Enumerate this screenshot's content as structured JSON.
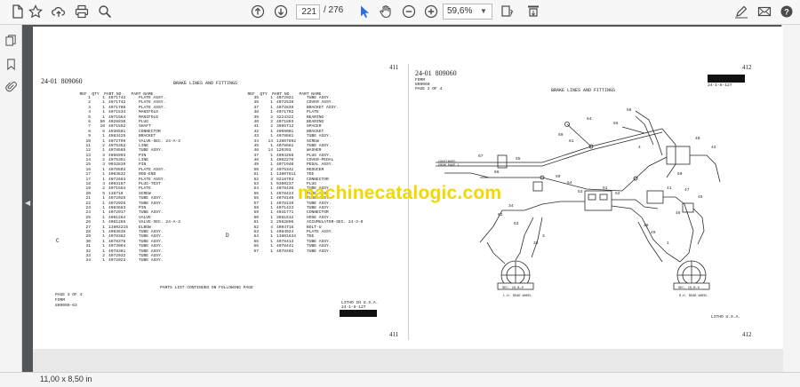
{
  "toolbar": {
    "current_page": "221",
    "total_pages": "/ 276",
    "zoom": "59,6%"
  },
  "status": {
    "page_size": "11,00 x 8,50 in"
  },
  "watermark": "machinecatalogic.com",
  "left_page": {
    "header_code": "24-01",
    "header_serial": "809060",
    "page_number": "411",
    "title": "BRAKE LINES AND FITTINGS",
    "col_headers": [
      "REF",
      "QTY",
      "PART NO",
      "PART NAME"
    ],
    "left_rows": [
      [
        "1",
        "1",
        "4071742",
        "PLATE ASSY."
      ],
      [
        "2",
        "1",
        "4071742",
        "PLATE ASSY."
      ],
      [
        "3",
        "1",
        "4071706",
        "PLATE ASSY."
      ],
      [
        "4",
        "1",
        "4071534",
        "MANIFOLD"
      ],
      [
        "5",
        "1",
        "4071564",
        "MANIFOLD"
      ],
      [
        "6",
        "50",
        "4026830",
        "PLUG"
      ],
      [
        "7",
        "10",
        "4071552",
        "SHAFT"
      ],
      [
        "8",
        "6",
        "4036581",
        "CONNECTOR"
      ],
      [
        "9",
        "1",
        "4083425",
        "BRACKET"
      ],
      [
        "10",
        "1",
        "4072799",
        "VALVE-SEC. 24-A-3"
      ],
      [
        "11",
        "2",
        "4075352",
        "LINE"
      ],
      [
        "12",
        "1",
        "4078585",
        "TUBE ASSY."
      ],
      [
        "13",
        "3",
        "4066993",
        "PIN"
      ],
      [
        "14",
        "2",
        "4075351",
        "LINE"
      ],
      [
        "15",
        "3",
        "9032839",
        "PIN"
      ],
      [
        "16",
        "1",
        "4078503",
        "PLATE ASSY."
      ],
      [
        "17",
        "1",
        "4083632",
        "ROD-END"
      ],
      [
        "17",
        "1",
        "4072663",
        "PLATE ASSY."
      ],
      [
        "18",
        "4",
        "4093187",
        "PLUG-TEST"
      ],
      [
        "19",
        "2",
        "4071554",
        "PLATE"
      ],
      [
        "20",
        "5",
        "138719",
        "SCREW"
      ],
      [
        "21",
        "1",
        "4072025",
        "TUBE ASSY."
      ],
      [
        "22",
        "1",
        "4072026",
        "TUBE ASSY."
      ],
      [
        "23",
        "1",
        "4083683",
        "PIN"
      ],
      [
        "24",
        "1",
        "4072017",
        "TUBE ASSY."
      ],
      [
        "25",
        "1",
        "4061264",
        "VALVE"
      ],
      [
        "26",
        "1",
        "4061265",
        "VALVE-SEC. 24-A-3"
      ],
      [
        "27",
        "1",
        "13802215",
        "ELBOW"
      ],
      [
        "28",
        "1",
        "4083635",
        "TUBE ASSY."
      ],
      [
        "29",
        "1",
        "4078382",
        "TUBE ASSY."
      ],
      [
        "30",
        "1",
        "4078378",
        "TUBE ASSY."
      ],
      [
        "31",
        "1",
        "4073094",
        "TUBE ASSY."
      ],
      [
        "32",
        "1",
        "4078381",
        "TUBE ASSY."
      ],
      [
        "33",
        "2",
        "4072032",
        "TUBE ASSY."
      ],
      [
        "34",
        "1",
        "4072023",
        "TUBE ASSY."
      ]
    ],
    "left_markers": {
      "C": "C"
    },
    "right_rows": [
      [
        "35",
        "1",
        "4072021",
        "TUBE ASSY."
      ],
      [
        "36",
        "1",
        "4072539",
        "COVER ASSY."
      ],
      [
        "37",
        "1",
        "4072839",
        "BRACKET ASSY."
      ],
      [
        "38",
        "1",
        "4071702",
        "PLATE"
      ],
      [
        "39",
        "2",
        "3224322",
        "BEARING"
      ],
      [
        "40",
        "2",
        "4071893",
        "BEARING"
      ],
      [
        "41",
        "2",
        "3985712",
        "SPACER"
      ],
      [
        "42",
        "1",
        "4069001",
        "BRACKET"
      ],
      [
        "43",
        "1",
        "4078661",
        "TUBE ASSY."
      ],
      [
        "44",
        "14",
        "13807692",
        "SCREW"
      ],
      [
        "45",
        "1",
        "4078662",
        "TUBE ASSY."
      ],
      [
        "46",
        "14",
        "120393",
        "WASHER"
      ],
      [
        "47",
        "1",
        "4094266",
        "PLUG ASSY."
      ],
      [
        "48",
        "1",
        "4062270",
        "COVER-PEDAL"
      ],
      [
        "49",
        "1",
        "4071940",
        "PEDAL ASSY."
      ],
      [
        "50",
        "2",
        "4075342",
        "REDUCER"
      ],
      [
        "51",
        "1",
        "13807611",
        "TEE"
      ],
      [
        "52",
        "3",
        "9218703",
        "CONNECTOR"
      ],
      [
        "53",
        "1",
        "9300237",
        "PLUG"
      ],
      [
        "54",
        "1",
        "4078436",
        "TUBE ASSY."
      ],
      [
        "55",
        "1",
        "4078423",
        "TUBE ASSY."
      ],
      [
        "56",
        "1",
        "4078140",
        "TUBE ASSY."
      ],
      [
        "57",
        "1",
        "4078139",
        "TUBE ASSY."
      ],
      [
        "58",
        "1",
        "4071423",
        "TUBE ASSY."
      ],
      [
        "59",
        "1",
        "4031771",
        "CONNECTOR"
      ],
      [
        "60",
        "1",
        "3981512",
        "HOSE ASSY."
      ],
      [
        "61",
        "2",
        "2562896",
        "ACCUMULATOR-SEC. 24-3-0"
      ],
      [
        "62",
        "4",
        "4094716",
        "BOLT-U"
      ],
      [
        "63",
        "1",
        "4084924",
        "PLATE ASSY."
      ],
      [
        "64",
        "1",
        "13801634",
        "TEE"
      ],
      [
        "65",
        "1",
        "4078413",
        "TUBE ASSY."
      ],
      [
        "66",
        "1",
        "4078441",
        "TUBE ASSY."
      ],
      [
        "67",
        "1",
        "4078402",
        "TUBE ASSY."
      ]
    ],
    "right_marker": "D",
    "continued": "PARTS LIST CONTINUED ON FOLLOWING PAGE",
    "footer_page_of": "PAGE 3 OF 4",
    "footer_form": "FORM",
    "footer_serial": "809060-63",
    "litho": "LITHO IN U.S.A.",
    "litho_date": "24-1-8-127",
    "bottom_page_number": "411"
  },
  "right_page": {
    "header_code": "24-01",
    "header_serial": "809060",
    "form": "FORM",
    "form_serial": "809060",
    "page_of": "PAGE 2 OF 4",
    "page_number": "412",
    "date_code": "24-1-8-127",
    "title": "BRAKE LINES AND FITTINGS",
    "label_continued": "CONTINUED FROM PAGE 1",
    "label_lh": "L.H. REAR WHEEL",
    "label_rh": "R.H. REAR WHEEL",
    "label_sec_left": "SEC. 16-B-0",
    "label_sec_right": "SEC. 16-B-0",
    "litho": "LITHO U.S.A.",
    "bottom_page_number": "412",
    "callouts": [
      "58",
      "64",
      "65",
      "60",
      "61",
      "4",
      "67",
      "66",
      "55",
      "59",
      "54",
      "40",
      "43",
      "50",
      "53",
      "41",
      "47",
      "45",
      "51",
      "52",
      "46",
      "34",
      "62",
      "63",
      "48",
      "49",
      "3",
      "33",
      "1"
    ]
  }
}
